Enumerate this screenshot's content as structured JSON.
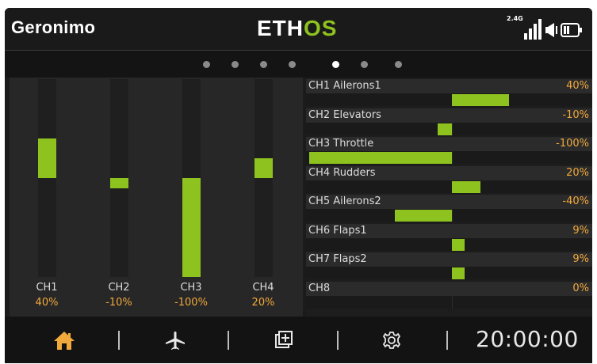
{
  "header": {
    "model_name": "Geronimo",
    "logo": {
      "left": "ETH",
      "right": "OS"
    },
    "signal_band": "2.4G",
    "icons": [
      "signal-bars-icon",
      "speaker-icon",
      "battery-icon"
    ]
  },
  "pager": {
    "count": 7,
    "active_index": 4
  },
  "bars": {
    "channels": [
      {
        "label": "CH1",
        "value_text": "40%",
        "value": 40
      },
      {
        "label": "CH2",
        "value_text": "-10%",
        "value": -10
      },
      {
        "label": "CH3",
        "value_text": "-100%",
        "value": -100
      },
      {
        "label": "CH4",
        "value_text": "20%",
        "value": 20
      }
    ]
  },
  "list": {
    "channels": [
      {
        "name": "CH1 Ailerons1",
        "value_text": "40%",
        "value": 40
      },
      {
        "name": "CH2 Elevators",
        "value_text": "-10%",
        "value": -10
      },
      {
        "name": "CH3 Throttle",
        "value_text": "-100%",
        "value": -100
      },
      {
        "name": "CH4 Rudders",
        "value_text": "20%",
        "value": 20
      },
      {
        "name": "CH5 Ailerons2",
        "value_text": "-40%",
        "value": -40
      },
      {
        "name": "CH6 Flaps1",
        "value_text": "9%",
        "value": 9
      },
      {
        "name": "CH7 Flaps2",
        "value_text": "9%",
        "value": 9
      },
      {
        "name": "CH8",
        "value_text": "0%",
        "value": 0
      }
    ]
  },
  "footer": {
    "icons": [
      "home-icon",
      "airplane-icon",
      "system-tools-icon",
      "settings-gear-icon"
    ],
    "clock": "20:00:00"
  },
  "colors": {
    "accent": "#8dc21f",
    "value_text": "#f2a93b",
    "active_home": "#f2a93b"
  }
}
